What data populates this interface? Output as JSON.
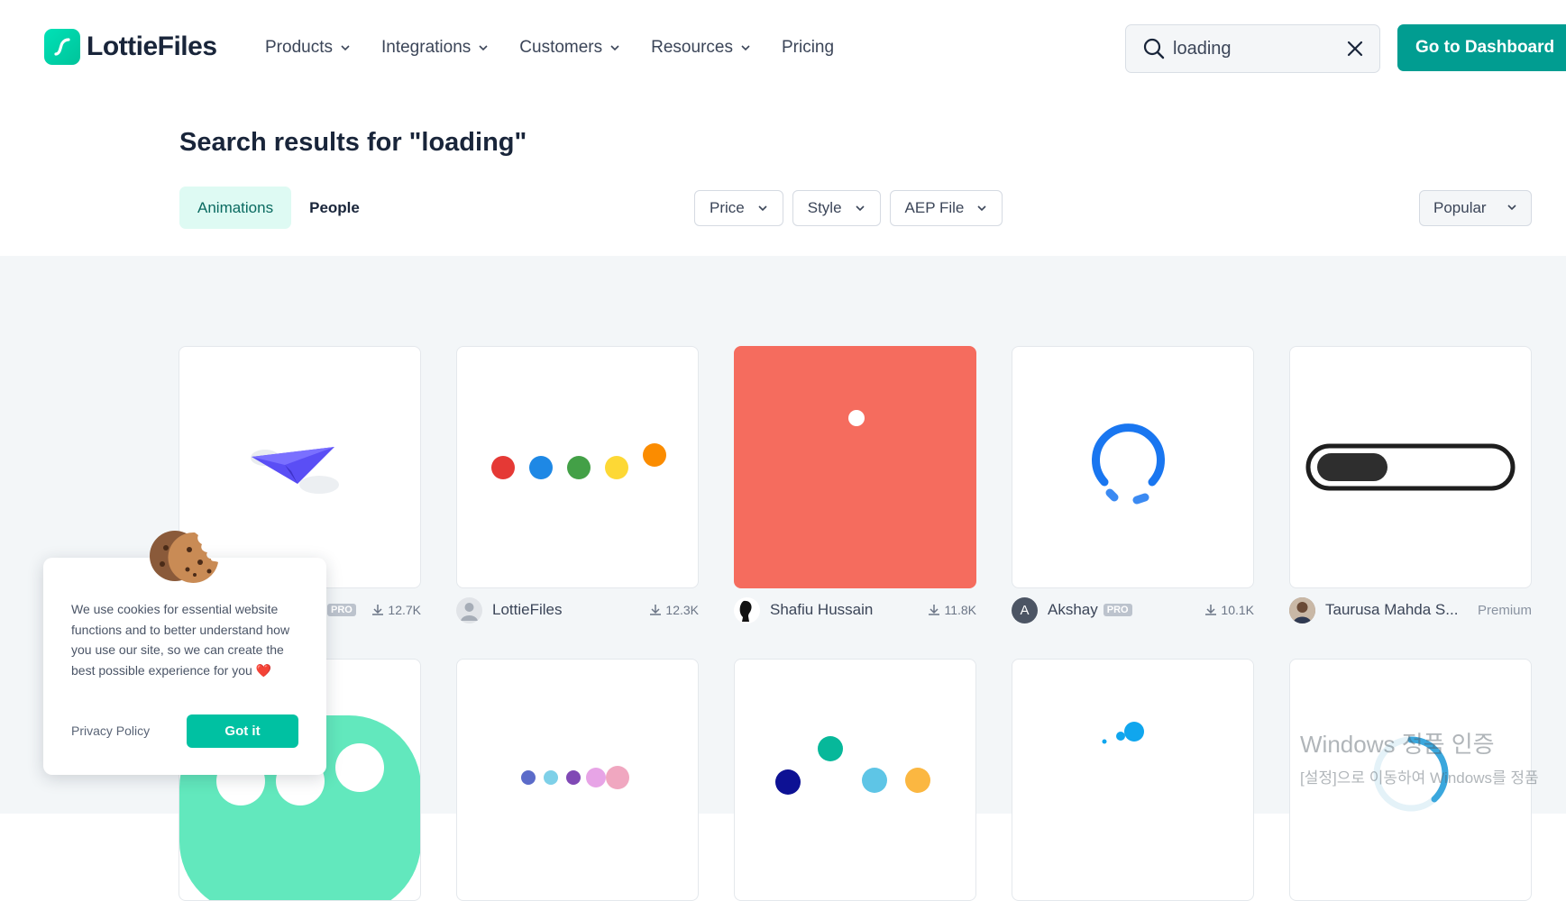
{
  "brand": {
    "name": "LottieFiles",
    "accent": "#00c1a2",
    "dashboard_btn_color": "#019d91"
  },
  "nav": {
    "items": [
      {
        "label": "Products",
        "has_menu": true
      },
      {
        "label": "Integrations",
        "has_menu": true
      },
      {
        "label": "Customers",
        "has_menu": true
      },
      {
        "label": "Resources",
        "has_menu": true
      },
      {
        "label": "Pricing",
        "has_menu": false
      }
    ]
  },
  "search": {
    "value": "loading",
    "icon": "search-icon",
    "clear_icon": "close-icon"
  },
  "dashboard_button": "Go to Dashboard",
  "heading": "Search results for \"loading\"",
  "tabs": [
    {
      "label": "Animations",
      "active": true
    },
    {
      "label": "People",
      "active": false
    }
  ],
  "filters": [
    {
      "label": "Price"
    },
    {
      "label": "Style"
    },
    {
      "label": "AEP File"
    }
  ],
  "sort": {
    "label": "Popular"
  },
  "results": [
    {
      "animation": "paper-plane",
      "author": "",
      "pro": true,
      "downloads": "12.7K"
    },
    {
      "animation": "colored-dots",
      "author": "LottieFiles",
      "pro": false,
      "downloads": "12.3K"
    },
    {
      "animation": "coral-bouncing-dot",
      "author": "Shafiu Hussain",
      "pro": false,
      "downloads": "11.8K"
    },
    {
      "animation": "blue-spinner",
      "author": "Akshay",
      "avatar_letter": "A",
      "pro": true,
      "downloads": "10.1K"
    },
    {
      "animation": "progress-toggle",
      "author": "Taurusa Mahda S...",
      "pro": false,
      "badge": "Premium"
    },
    {
      "animation": "green-bubble"
    },
    {
      "animation": "small-dots-row"
    },
    {
      "animation": "triangle-dots"
    },
    {
      "animation": "blue-drops"
    },
    {
      "animation": "light-spinner"
    }
  ],
  "badges": {
    "pro": "PRO"
  },
  "cookie": {
    "text": "We use cookies for essential website functions and to better understand how you use our site, so we can create the best possible experience for you",
    "heart": "❤️",
    "privacy_link": "Privacy Policy",
    "accept_button": "Got it"
  },
  "watermark": {
    "line1": "Windows 정품 인증",
    "line2": "[설정]으로 이동하여 Windows를 정품"
  }
}
